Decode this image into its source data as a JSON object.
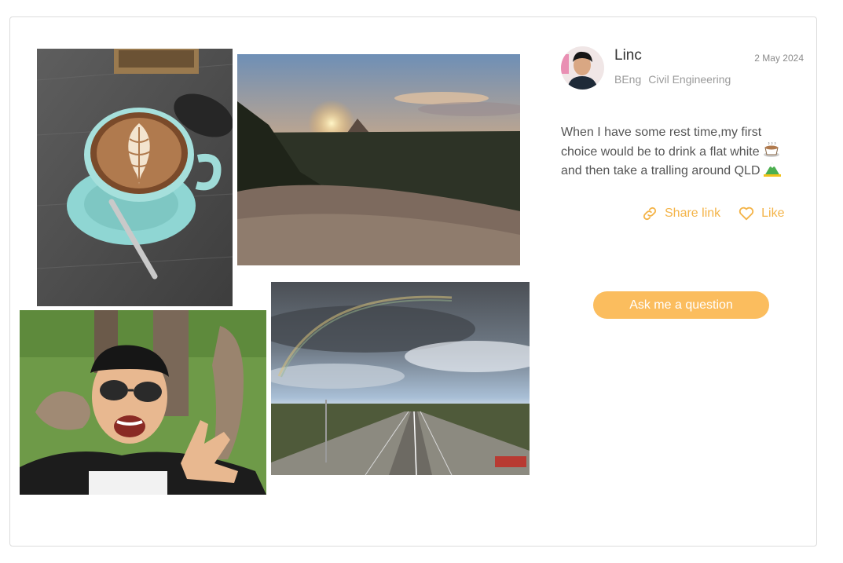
{
  "post": {
    "author_name": "Linc",
    "date": "2 May 2024",
    "degree": "BEng",
    "major": "Civil Engineering",
    "bio_line1": "When I have some rest time,my first",
    "bio_line2": "choice would be to drink a flat white",
    "bio_line3": "and then take a tralling around QLD",
    "share_label": "Share link",
    "like_label": "Like",
    "ask_label": "Ask me a question"
  },
  "photos": [
    {
      "name": "photo-coffee",
      "subject": "latte art coffee cup on saucer"
    },
    {
      "name": "photo-sunset",
      "subject": "sunset over mountains"
    },
    {
      "name": "photo-selfie-kangaroos",
      "subject": "selfie with kangaroos"
    },
    {
      "name": "photo-highway-rainbow",
      "subject": "highway under cloudy sky with rainbow"
    }
  ],
  "icons": {
    "share": "link-icon",
    "like": "heart-icon",
    "emoji1": "coffee-emoji",
    "emoji2": "mountain-emoji"
  },
  "colors": {
    "accent": "#f4b449",
    "button": "#fbbd5e"
  }
}
